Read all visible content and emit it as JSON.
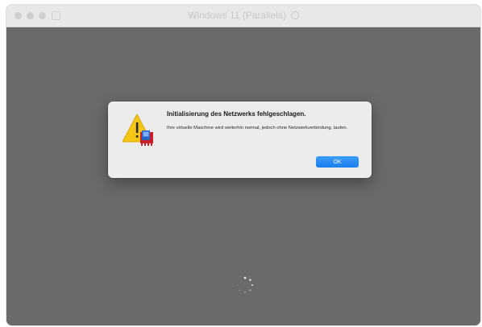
{
  "window": {
    "title": "Windows 11 (Parallels)"
  },
  "dialog": {
    "title": "Initialisierung des Netzwerks fehlgeschlagen.",
    "message": "Ihre virtuelle Maschine wird weiterhin normal, jedoch ohne Netzwerkverbindung, laufen.",
    "ok_label": "OK",
    "icon": "warning-triangle-with-network-adapter-icon"
  },
  "colors": {
    "vm_background": "#6a6a6a",
    "dialog_background": "#ececec",
    "accent_button": "#1a7ff0",
    "warning_yellow": "#f5c518"
  }
}
